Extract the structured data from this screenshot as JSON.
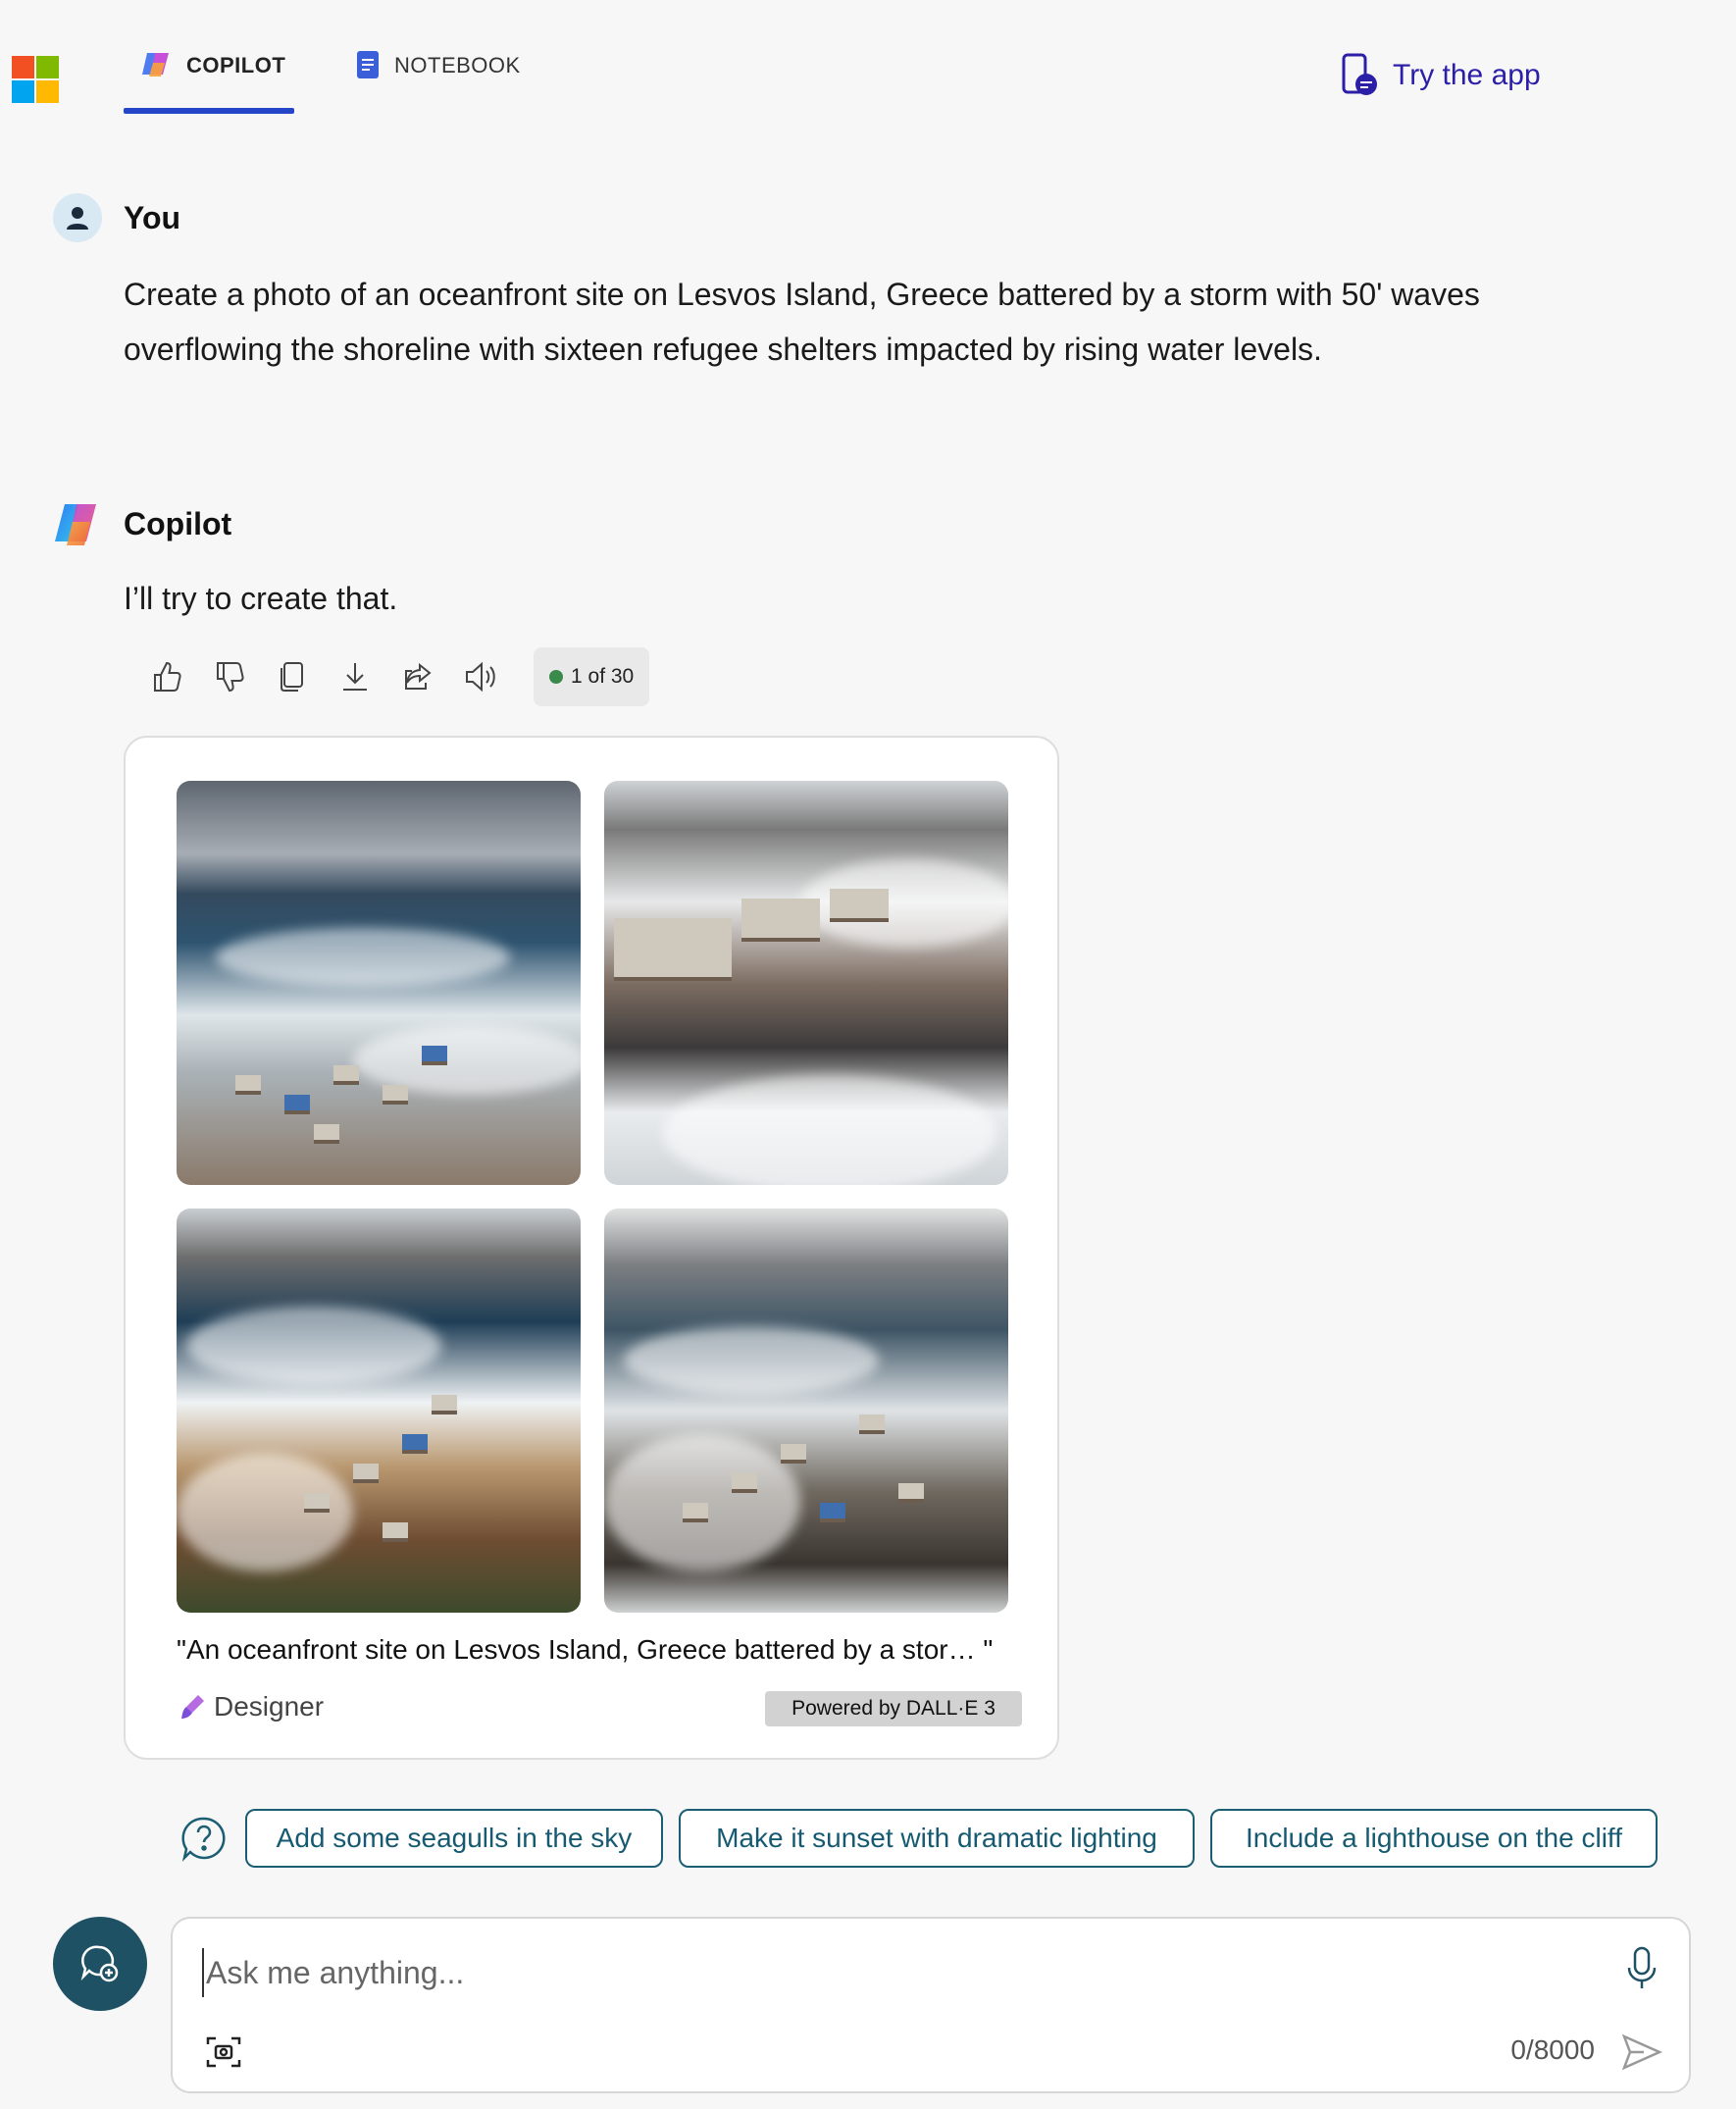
{
  "header": {
    "tabs": [
      {
        "label": "COPILOT",
        "active": true
      },
      {
        "label": "NOTEBOOK",
        "active": false
      }
    ],
    "try_app_label": "Try the app"
  },
  "user_message": {
    "author": "You",
    "text": "Create a photo of an oceanfront site on Lesvos Island, Greece battered by a storm with 50' waves overflowing the shoreline with sixteen refugee shelters impacted by rising water levels."
  },
  "bot_message": {
    "author": "Copilot",
    "text": "I’ll try to create that.",
    "counter": "1 of 30",
    "action_icons": [
      "thumbs-up-icon",
      "thumbs-down-icon",
      "copy-icon",
      "download-icon",
      "share-icon",
      "read-aloud-icon"
    ]
  },
  "image_card": {
    "caption": "\"An oceanfront site on Lesvos Island, Greece battered by a stor…   \"",
    "designer_label": "Designer",
    "powered_label": "Powered by DALL·E 3",
    "image_count": 4
  },
  "suggestions": [
    "Add some seagulls in the sky",
    "Make it sunset with dramatic lighting",
    "Include a lighthouse on the cliff"
  ],
  "composer": {
    "placeholder": "Ask me anything...",
    "char_count": "0/8000"
  },
  "colors": {
    "accent": "#2546c9",
    "chip_border": "#1b5e74",
    "new_topic_bg": "#1f5165",
    "status_dot": "#3a8a4c"
  }
}
